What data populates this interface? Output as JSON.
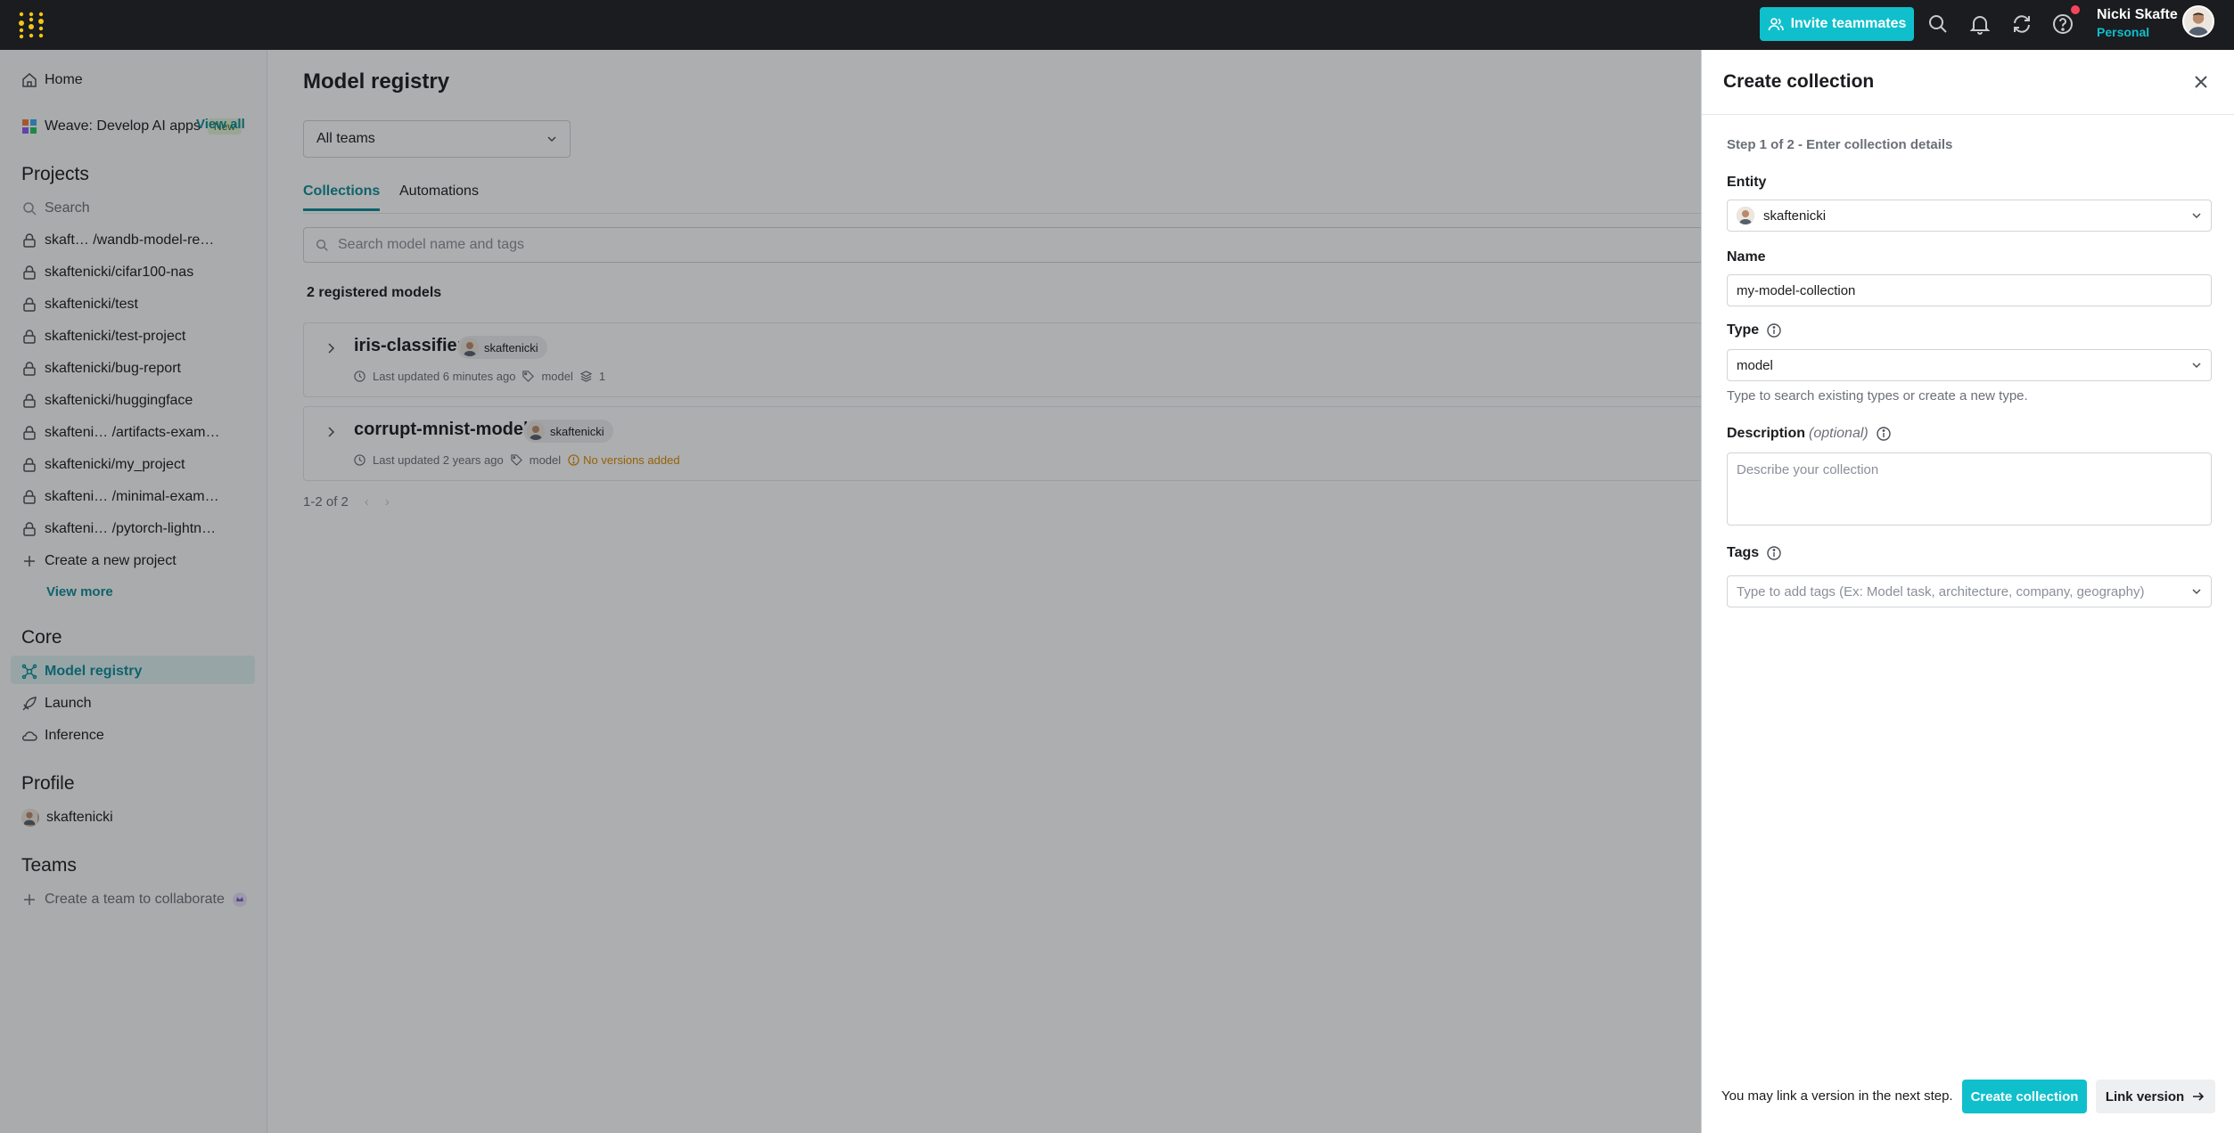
{
  "topbar": {
    "invite_label": "Invite teammates",
    "user_name": "Nicki Skafte",
    "user_org": "Personal"
  },
  "sidebar": {
    "home": "Home",
    "weave": "Weave: Develop AI apps",
    "weave_badge": "New",
    "projects_heading": "Projects",
    "view_all": "View all",
    "search_placeholder": "Search",
    "projects": [
      "skaft… /wandb-model-re…",
      "skaftenicki/cifar100-nas",
      "skaftenicki/test",
      "skaftenicki/test-project",
      "skaftenicki/bug-report",
      "skaftenicki/huggingface",
      "skafteni… /artifacts-exam…",
      "skaftenicki/my_project",
      "skafteni… /minimal-exam…",
      "skafteni… /pytorch-lightn…"
    ],
    "create_project": "Create a new project",
    "view_more": "View more",
    "core_heading": "Core",
    "core_items": [
      "Model registry",
      "Launch",
      "Inference"
    ],
    "profile_heading": "Profile",
    "profile_user": "skaftenicki",
    "teams_heading": "Teams",
    "create_team": "Create a team to collaborate"
  },
  "main": {
    "title": "Model registry",
    "team_filter": "All teams",
    "tabs": [
      "Collections",
      "Automations"
    ],
    "search_placeholder": "Search model name and tags",
    "registered_count": "2 registered models",
    "models": [
      {
        "name": "iris-classifier",
        "owner": "skaftenicki",
        "updated": "Last updated 6 minutes ago",
        "type": "model",
        "versions": "1"
      },
      {
        "name": "corrupt-mnist-model",
        "owner": "skaftenicki",
        "updated": "Last updated 2 years ago",
        "type": "model",
        "versions": "No versions added"
      }
    ],
    "pager": "1-2 of 2"
  },
  "drawer": {
    "title": "Create collection",
    "step": "Step 1 of 2 - Enter collection details",
    "entity_label": "Entity",
    "entity_value": "skaftenicki",
    "name_label": "Name",
    "name_value": "my-model-collection",
    "type_label": "Type",
    "type_value": "model",
    "type_hint": "Type to search existing types or create a new type.",
    "description_label": "Description",
    "description_optional": "(optional)",
    "description_placeholder": "Describe your collection",
    "tags_label": "Tags",
    "tags_placeholder": "Type to add tags (Ex: Model task, architecture, company, geography)",
    "footer_note": "You may link a version in the next step.",
    "create_button": "Create collection",
    "link_button": "Link version"
  },
  "colors": {
    "accent": "#10bfcc",
    "accent_dark": "#0c8c99",
    "topbar": "#1a1c1f",
    "warning": "#d98a00",
    "notification": "#f5455c"
  },
  "icons": {
    "logo": "wandb-logo-icon",
    "search": "search-icon",
    "bell": "bell-icon",
    "refresh": "refresh-icon",
    "help": "help-icon",
    "close": "close-icon",
    "lock": "lock-icon",
    "home": "home-icon"
  }
}
